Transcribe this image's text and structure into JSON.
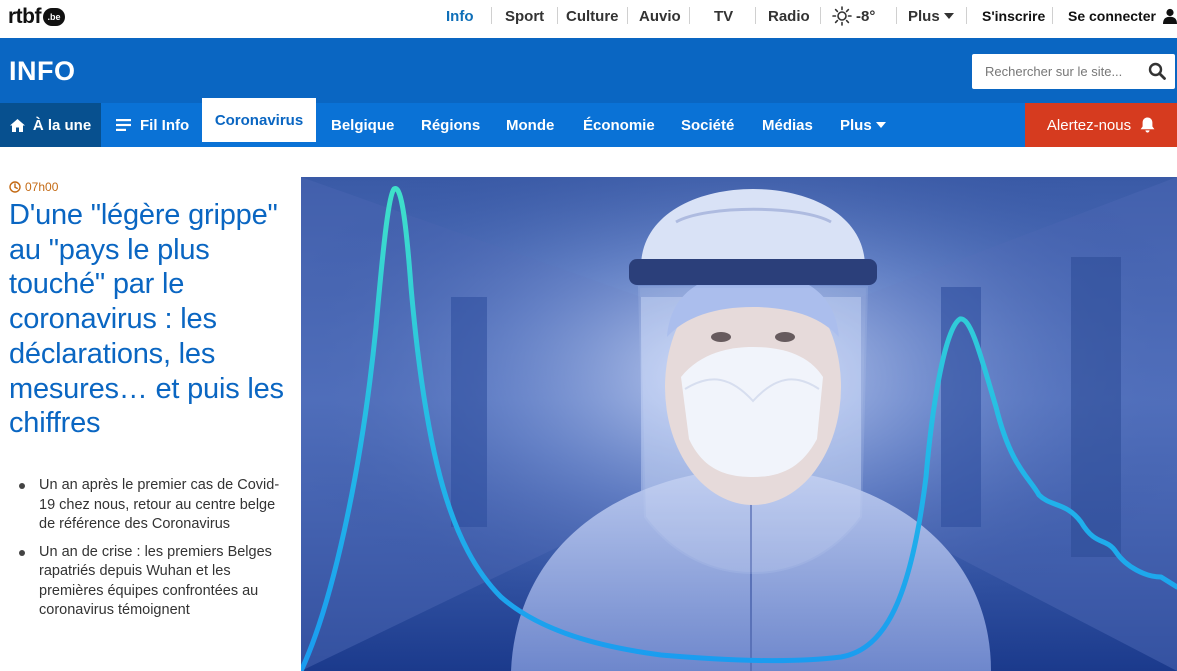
{
  "brand": {
    "logo_text": "rtbf",
    "logo_badge": ".be"
  },
  "topnav": {
    "items": [
      {
        "label": "Info",
        "active": true
      },
      {
        "label": "Sport"
      },
      {
        "label": "Culture"
      },
      {
        "label": "Auvio"
      },
      {
        "label": "TV"
      },
      {
        "label": "Radio"
      }
    ],
    "weather": {
      "icon": "sun-icon",
      "temperature": "-8°"
    },
    "more": "Plus",
    "signup": "S'inscrire",
    "login": "Se connecter"
  },
  "section": {
    "title": "INFO",
    "search_placeholder": "Rechercher sur le site..."
  },
  "mainnav": {
    "home": "À la une",
    "filinfo": "Fil Info",
    "active": "Coronavirus",
    "items": [
      "Belgique",
      "Régions",
      "Monde",
      "Économie",
      "Société",
      "Médias"
    ],
    "more": "Plus",
    "alert": "Alertez-nous"
  },
  "article": {
    "time": "07h00",
    "headline": "D'une \"légère grippe\" au \"pays le plus touché\" par le coronavirus : les déclarations, les mesures… et puis les chiffres",
    "related": [
      "Un an après le premier cas de Covid-19 chez nous, retour au centre belge de référence des Coronavirus",
      "Un an de crise : les premiers Belges rapatriés depuis Wuhan et les premières équipes confrontées au coronavirus témoignent"
    ]
  },
  "colors": {
    "brand_blue": "#0a66c2",
    "nav_blue": "#0a72d6",
    "home_blue": "#07508f",
    "alert_red": "#d63b1f",
    "time_orange": "#c46a14"
  }
}
